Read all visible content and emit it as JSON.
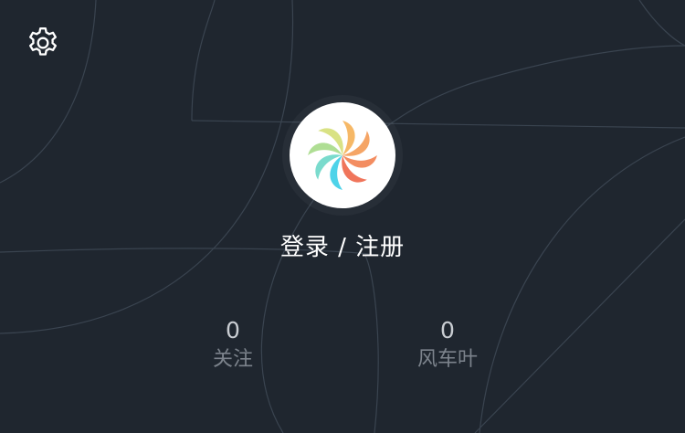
{
  "header": {
    "settings_icon": "gear-icon"
  },
  "profile": {
    "avatar_icon": "pinwheel-logo",
    "login_label": "登录 / 注册"
  },
  "stats": {
    "follow": {
      "value": "0",
      "label": "关注"
    },
    "windmill": {
      "value": "0",
      "label": "风车叶"
    }
  },
  "colors": {
    "background": "#1f262f",
    "text_primary": "#ffffff",
    "text_secondary": "#7c838c"
  }
}
